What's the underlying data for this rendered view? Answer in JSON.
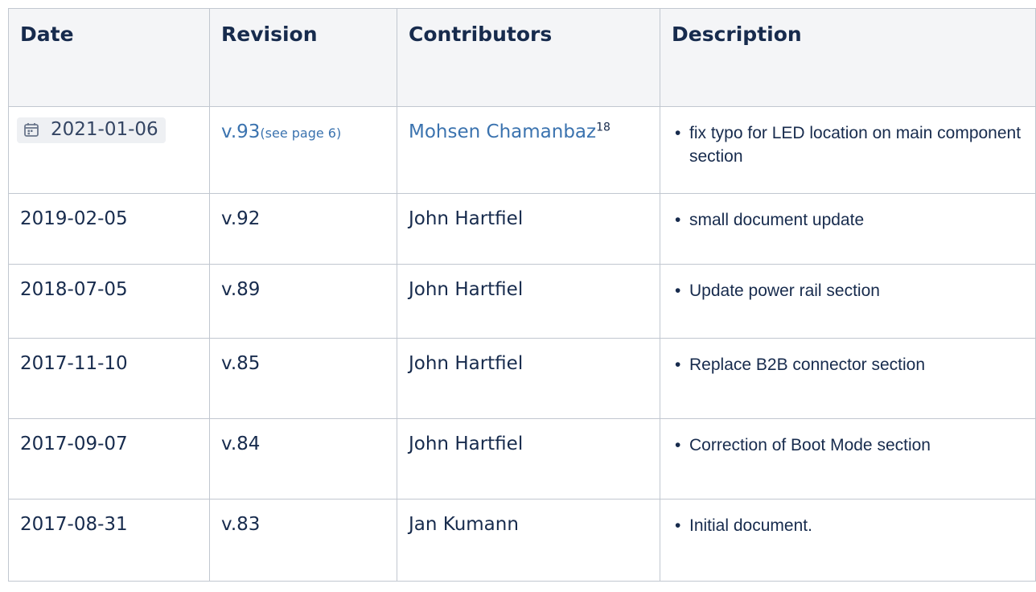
{
  "table": {
    "headers": {
      "date": "Date",
      "revision": "Revision",
      "contributors": "Contributors",
      "description": "Description"
    },
    "rows": [
      {
        "date": "2021-01-06",
        "revision": "v.93",
        "revision_link": "(see page 6)",
        "contributor": "Mohsen Chamanbaz",
        "footnote": "18",
        "description": "fix typo for LED location on main component section"
      },
      {
        "date": "2019-02-05",
        "revision": "v.92",
        "contributor": "John Hartfiel",
        "description": "small document update"
      },
      {
        "date": "2018-07-05",
        "revision": "v.89",
        "contributor": "John Hartfiel",
        "description": "Update power rail section"
      },
      {
        "date": "2017-11-10",
        "revision": "v.85",
        "contributor": "John Hartfiel",
        "description": "Replace B2B connector section"
      },
      {
        "date": "2017-09-07",
        "revision": "v.84",
        "contributor": "John Hartfiel",
        "description": "Correction of Boot Mode section"
      },
      {
        "date": "2017-08-31",
        "revision": "v.83",
        "contributor": "Jan Kumann",
        "description": "Initial document."
      }
    ]
  },
  "icons": {
    "bullet": "•",
    "calendar": "calendar-icon"
  },
  "colors": {
    "link": "#3b73af",
    "header_bg": "#f4f5f7",
    "border": "#c1c7d0",
    "text": "#172b4d",
    "lozenge_bg": "#eef0f3"
  }
}
